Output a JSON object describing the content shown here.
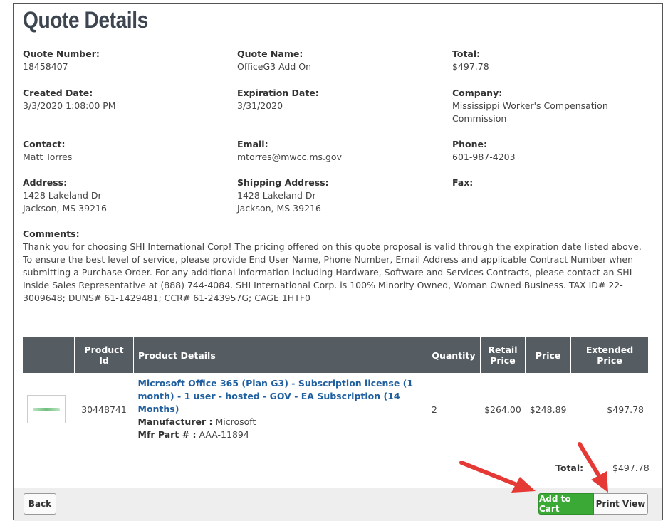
{
  "page": {
    "title": "Quote Details"
  },
  "fields": {
    "quote_number": {
      "label": "Quote Number:",
      "value": "18458407"
    },
    "quote_name": {
      "label": "Quote Name:",
      "value": "OfficeG3 Add On"
    },
    "total": {
      "label": "Total:",
      "value": "$497.78"
    },
    "created_date": {
      "label": "Created Date:",
      "value": "3/3/2020 1:08:00 PM"
    },
    "expiration_date": {
      "label": "Expiration Date:",
      "value": "3/31/2020"
    },
    "company": {
      "label": "Company:",
      "value": "Mississippi Worker's Compensation\nCommission"
    },
    "contact": {
      "label": "Contact:",
      "value": "Matt Torres"
    },
    "email": {
      "label": "Email:",
      "value": "mtorres@mwcc.ms.gov"
    },
    "phone": {
      "label": "Phone:",
      "value": "601-987-4203"
    },
    "address": {
      "label": "Address:",
      "value": "1428 Lakeland Dr\nJackson, MS 39216"
    },
    "shipping_address": {
      "label": "Shipping Address:",
      "value": "1428 Lakeland Dr\nJackson, MS 39216"
    },
    "fax": {
      "label": "Fax:",
      "value": ""
    }
  },
  "comments": {
    "label": "Comments:",
    "text": "Thank you for choosing SHI International Corp! The pricing offered on this quote proposal is valid through the expiration date listed above. To ensure the best level of service, please provide End User Name, Phone Number, Email Address and applicable Contract Number when submitting a Purchase Order. For any additional information including Hardware, Software and Services Contracts, please contact an SHI Inside Sales Representative at (888) 744-4084. SHI International Corp. is 100% Minority Owned, Woman Owned Business. TAX ID# 22-3009648; DUNS# 61-1429481; CCR# 61-243957G; CAGE 1HTF0"
  },
  "table": {
    "headers": {
      "image": "",
      "product_id": "Product Id",
      "product_details": "Product Details",
      "quantity": "Quantity",
      "retail_price": "Retail Price",
      "price": "Price",
      "extended_price": "Extended Price"
    },
    "rows": [
      {
        "image_icon": "product-thumbnail",
        "product_id": "30448741",
        "name": "Microsoft Office 365 (Plan G3) - Subscription license (1 month) - 1 user - hosted - GOV - EA Subscription (14 Months)",
        "manufacturer_label": "Manufacturer :",
        "manufacturer": "Microsoft",
        "mfr_part_label": "Mfr Part # :",
        "mfr_part": "AAA-11894",
        "quantity": "2",
        "retail_price": "$264.00",
        "price": "$248.89",
        "extended_price": "$497.78"
      }
    ]
  },
  "summary": {
    "total_label": "Total:",
    "total_value": "$497.78"
  },
  "footer": {
    "back_label": "Back",
    "add_to_cart_label": "Add to Cart",
    "print_view_label": "Print View"
  },
  "colors": {
    "header_bg": "#555d63",
    "link": "#1f5fa0",
    "cart_green": "#3aa935",
    "annotation_red": "#e53935"
  }
}
